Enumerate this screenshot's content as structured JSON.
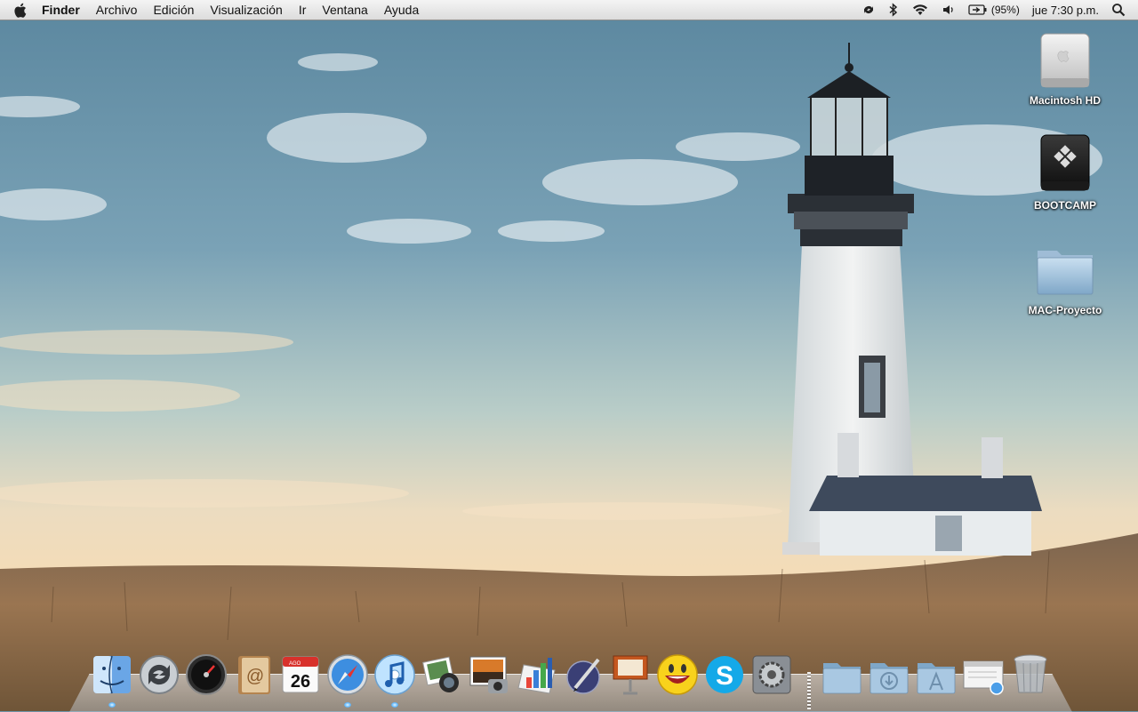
{
  "menubar": {
    "app_name": "Finder",
    "menus": [
      "Archivo",
      "Edición",
      "Visualización",
      "Ir",
      "Ventana",
      "Ayuda"
    ],
    "battery_percent": "(95%)",
    "clock": "jue 7:30 p.m.",
    "status_icons": [
      "sync-icon",
      "bluetooth-icon",
      "wifi-icon",
      "volume-icon",
      "battery-icon",
      "spotlight-icon"
    ]
  },
  "desktop": {
    "icons": [
      {
        "label": "Macintosh HD",
        "icon": "hard-drive-icon"
      },
      {
        "label": "BOOTCAMP",
        "icon": "bootcamp-drive-icon"
      },
      {
        "label": "MAC-Proyecto",
        "icon": "folder-icon"
      }
    ]
  },
  "dock": {
    "apps": [
      {
        "icon": "finder-icon",
        "running": true
      },
      {
        "icon": "sync-services-icon",
        "running": false
      },
      {
        "icon": "dashboard-icon",
        "running": false
      },
      {
        "icon": "address-book-icon",
        "running": false
      },
      {
        "icon": "ical-icon",
        "running": false,
        "month": "AGO",
        "day": "26"
      },
      {
        "icon": "safari-icon",
        "running": true
      },
      {
        "icon": "itunes-icon",
        "running": true
      },
      {
        "icon": "iphoto-icon",
        "running": false
      },
      {
        "icon": "image-capture-icon",
        "running": false
      },
      {
        "icon": "keynote-chart-icon",
        "running": false
      },
      {
        "icon": "ink-pen-icon",
        "running": false
      },
      {
        "icon": "keynote-icon",
        "running": false
      },
      {
        "icon": "yahoo-messenger-icon",
        "running": false
      },
      {
        "icon": "skype-icon",
        "running": false
      },
      {
        "icon": "system-preferences-icon",
        "running": false
      }
    ],
    "stacks": [
      {
        "icon": "folder-stack-icon"
      },
      {
        "icon": "downloads-stack-icon"
      },
      {
        "icon": "applications-stack-icon"
      },
      {
        "icon": "network-browser-icon"
      },
      {
        "icon": "trash-icon"
      }
    ]
  },
  "colors": {
    "sky_top": "#5f8aa3",
    "sky_horizon": "#f1dcbc",
    "grass": "#8d6a47",
    "dock_running_light": "#5cb6ff"
  }
}
